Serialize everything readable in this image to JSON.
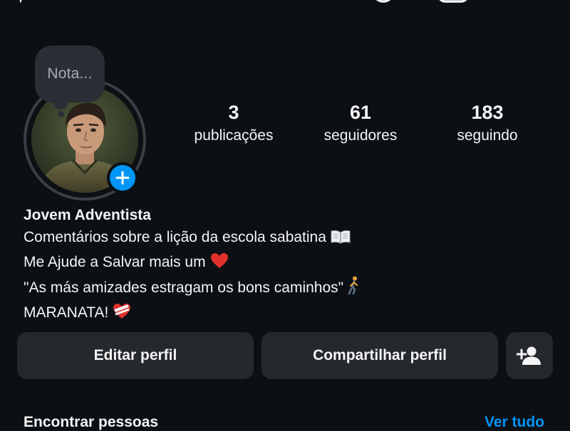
{
  "note": {
    "placeholder": "Nota..."
  },
  "profile": {
    "name": "Jovem Adventista",
    "bio": [
      {
        "text": "Comentários sobre a lição da escola sabatina",
        "emoji": "open-book-icon"
      },
      {
        "text": "Me Ajude a Salvar mais um",
        "emoji": "red-heart-icon"
      },
      {
        "text": "\"As más amizades estragam os bons caminhos\"",
        "emoji": "person-walking-icon"
      },
      {
        "text": "MARANATA!",
        "emoji": "mending-heart-icon"
      }
    ]
  },
  "stats": {
    "posts": {
      "value": "3",
      "label": "publicações"
    },
    "followers": {
      "value": "61",
      "label": "seguidores"
    },
    "following": {
      "value": "183",
      "label": "seguindo"
    }
  },
  "buttons": {
    "edit": "Editar perfil",
    "share": "Compartilhar perfil",
    "add_person_icon": "add-person-icon"
  },
  "discover": {
    "title": "Encontrar pessoas",
    "see_all": "Ver tudo"
  },
  "colors": {
    "background": "#0c1014",
    "button_bg": "#25292e",
    "accent": "#0095f6",
    "text": "#f5f5f5"
  }
}
